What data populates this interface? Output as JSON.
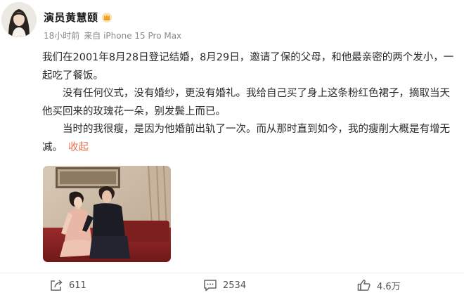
{
  "post": {
    "author": "演员黄慧颐",
    "time": "18小时前",
    "source": "来自 iPhone 15 Pro Max",
    "paragraphs": [
      "我们在2001年8月28日登记结婚，8月29日，邀请了保的父母，和他最亲密的两个发小，一起吃了餐饭。",
      "没有任何仪式，没有婚纱，更没有婚礼。我给自己买了身上这条粉红色裙子，摘取当天他买回来的玫瑰花一朵，别发鬓上而已。",
      "当时的我很瘦，是因为他婚前出轨了一次。而从那时直到如今，我的瘦削大概是有增无减。"
    ],
    "collapse_label": "收起"
  },
  "actions": {
    "share_count": "611",
    "comment_count": "2534",
    "like_count": "4.6万"
  },
  "icons": {
    "badge": "crown-icon",
    "share": "share-icon",
    "comment": "comment-icon",
    "like": "thumbs-up-icon"
  },
  "colors": {
    "accent": "#eb7350",
    "badge": "#f5a623"
  }
}
